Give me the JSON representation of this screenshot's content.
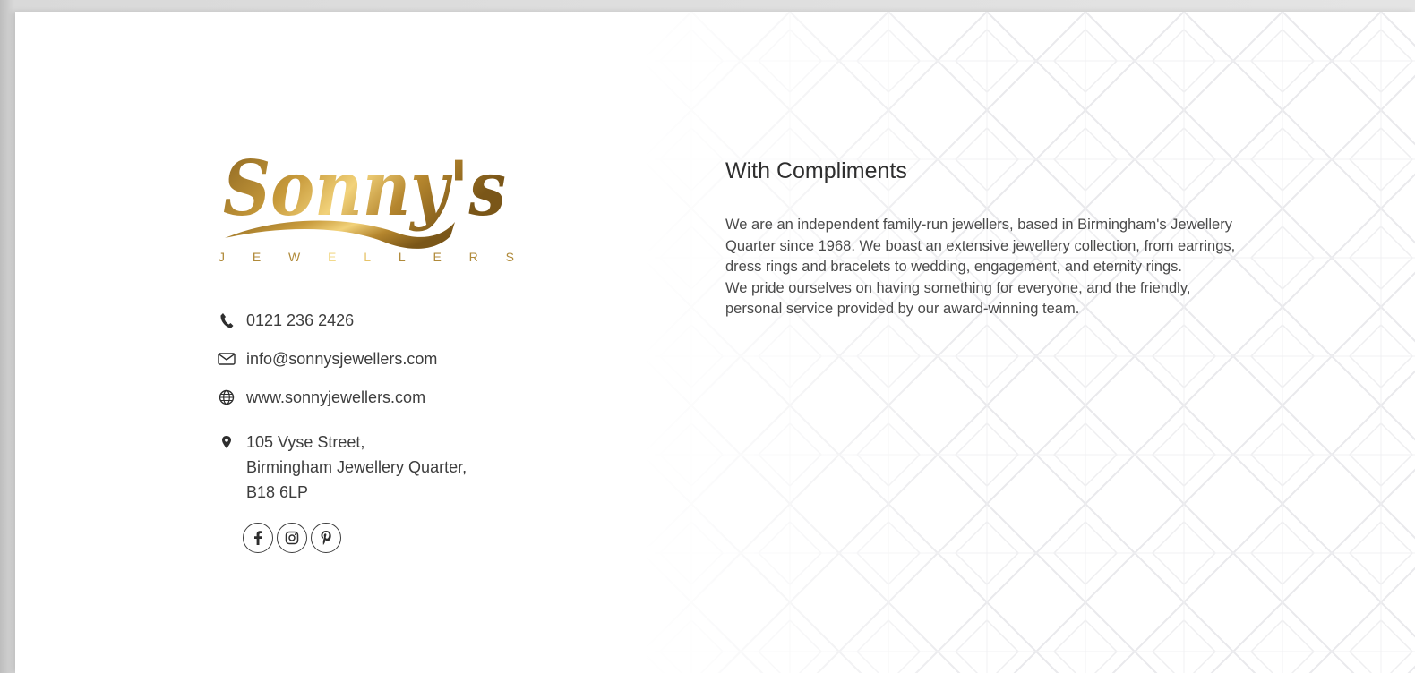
{
  "brand": {
    "script_name": "Sonny's",
    "sub_letters": [
      "J",
      "E",
      "W",
      "E",
      "L",
      "L",
      "E",
      "R",
      "S"
    ],
    "gold_dark": "#8a6420",
    "gold_light": "#f2d27a"
  },
  "contact": {
    "phone": "0121 236 2426",
    "email": "info@sonnysjewellers.com",
    "website": "www.sonnyjewellers.com",
    "address": [
      "105 Vyse Street,",
      "Birmingham Jewellery Quarter,",
      "B18 6LP"
    ]
  },
  "socials": [
    {
      "icon": "facebook-icon"
    },
    {
      "icon": "instagram-icon"
    },
    {
      "icon": "pinterest-icon"
    }
  ],
  "heading": "With Compliments",
  "about_lines": [
    "We are an independent family-run jewellers, based in Birmingham's Jewellery",
    "Quarter since 1968. We boast an extensive jewellery collection, from earrings,",
    "dress rings and bracelets to wedding, engagement, and eternity rings.",
    "We pride ourselves on having something for everyone, and the friendly,",
    "personal service provided by our award-winning team."
  ]
}
